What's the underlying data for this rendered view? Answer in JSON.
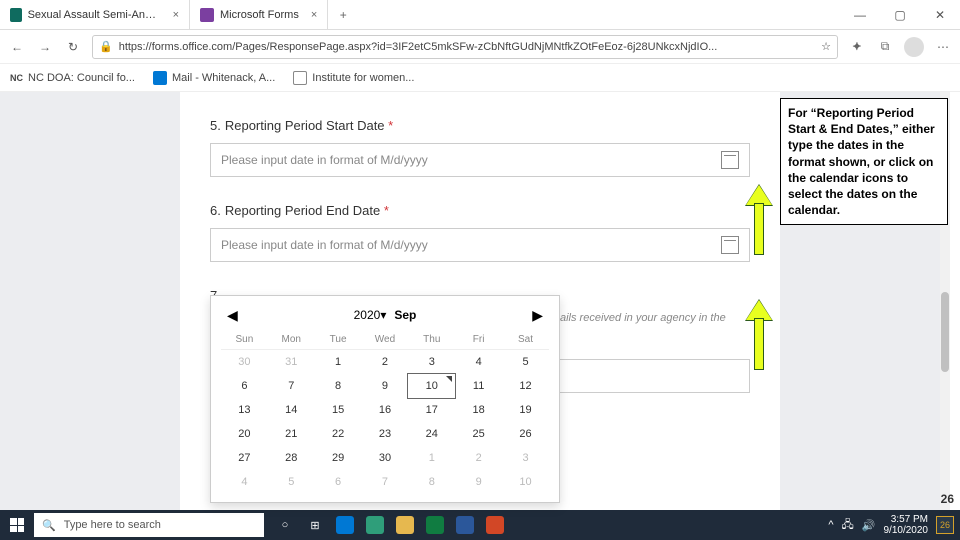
{
  "tabs": [
    {
      "title": "Sexual Assault Semi-Annual Stat"
    },
    {
      "title": "Microsoft Forms"
    }
  ],
  "window": {
    "min": "—",
    "max": "▢",
    "close": "✕",
    "plus": "+",
    "tabclose": "×"
  },
  "addr": {
    "back": "←",
    "fwd": "→",
    "reload": "↻",
    "lock": "🔒",
    "star": "☆",
    "fav": "⯌",
    "ext": "⧉",
    "more": "⋯",
    "url": "https://forms.office.com/Pages/ResponsePage.aspx?id=3IF2etC5mkSFw-zCbNftGUdNjMNtfkZOtFeEoz-6j28UNkcxNjdIO..."
  },
  "bookmarks": [
    {
      "label": "NC DOA: Council fo..."
    },
    {
      "label": "Mail - Whitenack, A..."
    },
    {
      "label": "Institute for women..."
    }
  ],
  "questions": {
    "q5": {
      "num": "5.",
      "label": "Reporting Period Start Date",
      "req": "*",
      "placeholder": "Please input date in format of M/d/yyyy"
    },
    "q6": {
      "num": "6.",
      "label": "Reporting Period End Date",
      "req": "*",
      "placeholder": "Please input date in format of M/d/yyyy"
    },
    "q7": {
      "num": "7.",
      "partial": "ails received in your agency in the"
    }
  },
  "calendar": {
    "prev": "◀",
    "next": "▶",
    "year": "2020",
    "month": "Sep",
    "dow": [
      "Sun",
      "Mon",
      "Tue",
      "Wed",
      "Thu",
      "Fri",
      "Sat"
    ],
    "rows": [
      [
        {
          "d": "30",
          "o": 1
        },
        {
          "d": "31",
          "o": 1
        },
        {
          "d": "1"
        },
        {
          "d": "2"
        },
        {
          "d": "3"
        },
        {
          "d": "4"
        },
        {
          "d": "5"
        }
      ],
      [
        {
          "d": "6"
        },
        {
          "d": "7"
        },
        {
          "d": "8"
        },
        {
          "d": "9"
        },
        {
          "d": "10",
          "t": 1
        },
        {
          "d": "11"
        },
        {
          "d": "12"
        }
      ],
      [
        {
          "d": "13"
        },
        {
          "d": "14"
        },
        {
          "d": "15"
        },
        {
          "d": "16"
        },
        {
          "d": "17"
        },
        {
          "d": "18"
        },
        {
          "d": "19"
        }
      ],
      [
        {
          "d": "20"
        },
        {
          "d": "21"
        },
        {
          "d": "22"
        },
        {
          "d": "23"
        },
        {
          "d": "24"
        },
        {
          "d": "25"
        },
        {
          "d": "26"
        }
      ],
      [
        {
          "d": "27"
        },
        {
          "d": "28"
        },
        {
          "d": "29"
        },
        {
          "d": "30"
        },
        {
          "d": "1",
          "o": 1
        },
        {
          "d": "2",
          "o": 1
        },
        {
          "d": "3",
          "o": 1
        }
      ],
      [
        {
          "d": "4",
          "o": 1
        },
        {
          "d": "5",
          "o": 1
        },
        {
          "d": "6",
          "o": 1
        },
        {
          "d": "7",
          "o": 1
        },
        {
          "d": "8",
          "o": 1
        },
        {
          "d": "9",
          "o": 1
        },
        {
          "d": "10",
          "o": 1
        }
      ]
    ]
  },
  "annotation": "For “Reporting Period Start & End Dates,” either type the dates in the format shown, or click on the calendar icons to select the dates on the calendar.",
  "taskbar": {
    "search_icon": "🔍",
    "search_ph": "Type here to search",
    "cortana": "○",
    "taskview": "⊞",
    "apps": [
      {
        "name": "outlook",
        "color": "#0078d4"
      },
      {
        "name": "edge",
        "color": "#2f9e7a"
      },
      {
        "name": "explorer",
        "color": "#e6b84f"
      },
      {
        "name": "excel",
        "color": "#107c41"
      },
      {
        "name": "word",
        "color": "#2b579a"
      },
      {
        "name": "powerpoint",
        "color": "#d24726"
      }
    ],
    "tray": {
      "up": "^",
      "net": "🖧",
      "vol": "🔊",
      "time": "3:57 PM",
      "date": "9/10/2020",
      "notif": "26"
    }
  },
  "pagenum": "26",
  "nc_label": "NC"
}
